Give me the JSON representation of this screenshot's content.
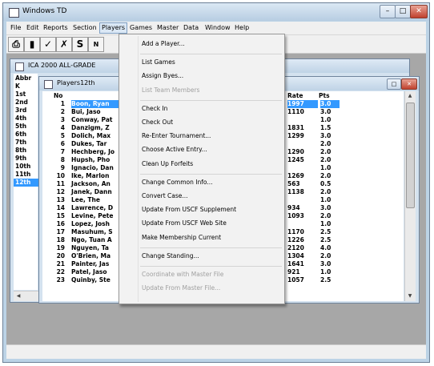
{
  "app": {
    "title": "Windows TD",
    "minimize": "–",
    "maximize": "□",
    "close": "✕"
  },
  "menubar": [
    "File",
    "Edit",
    "Reports",
    "Section",
    "Players",
    "Games",
    "Master",
    "Data",
    "Window",
    "Help"
  ],
  "toolbar": {
    "buttons": [
      {
        "name": "print-icon",
        "glyph": "⎙"
      },
      {
        "name": "bar-chart-icon",
        "glyph": "▮"
      },
      {
        "name": "checkmark-icon",
        "glyph": "✓"
      },
      {
        "name": "double-check-icon",
        "glyph": "✗"
      },
      {
        "name": "s-icon",
        "glyph": "S"
      },
      {
        "name": "n-icon",
        "glyph": "N"
      }
    ]
  },
  "section_window": {
    "title": "ICA 2000 ALL-GRADE",
    "header": "Abbr",
    "rows": [
      "K",
      "1st",
      "2nd",
      "3rd",
      "4th",
      "5th",
      "6th",
      "7th",
      "8th",
      "9th",
      "10th",
      "11th",
      "12th"
    ],
    "selected_index": 12
  },
  "players_window": {
    "title": "Players12th",
    "headers": {
      "no": "No",
      "rate": "Rate",
      "pts": "Pts"
    },
    "rows": [
      {
        "no": "1",
        "name": "Boon, Ryan",
        "rate": "1997",
        "pts": "3.0"
      },
      {
        "no": "2",
        "name": "Bui, Jaso",
        "rate": "1110",
        "pts": "3.0"
      },
      {
        "no": "3",
        "name": "Conway, Pat",
        "rate": "",
        "pts": "1.0"
      },
      {
        "no": "4",
        "name": "Danzigm, Z",
        "rate": "1831",
        "pts": "1.5"
      },
      {
        "no": "5",
        "name": "Dolich, Max",
        "rate": "1299",
        "pts": "3.0"
      },
      {
        "no": "6",
        "name": "Dukes, Tar",
        "rate": "",
        "pts": "2.0"
      },
      {
        "no": "7",
        "name": "Hechberg, Jo",
        "rate": "1290",
        "pts": "2.0"
      },
      {
        "no": "8",
        "name": "Hupsh, Pho",
        "rate": "1245",
        "pts": "2.0"
      },
      {
        "no": "9",
        "name": "Ignacio, Dan",
        "rate": "",
        "pts": "1.0"
      },
      {
        "no": "10",
        "name": "Ike, Marlon",
        "rate": "1269",
        "pts": "2.0"
      },
      {
        "no": "11",
        "name": "Jackson, An",
        "rate": "563",
        "pts": "0.5"
      },
      {
        "no": "12",
        "name": "Janek, Dann",
        "rate": "1138",
        "pts": "2.0"
      },
      {
        "no": "13",
        "name": "Lee, The",
        "rate": "",
        "pts": "1.0"
      },
      {
        "no": "14",
        "name": "Lawrence, D",
        "rate": "934",
        "pts": "3.0"
      },
      {
        "no": "15",
        "name": "Levine, Pete",
        "rate": "1093",
        "pts": "2.0"
      },
      {
        "no": "16",
        "name": "Lopez, Josh",
        "rate": "",
        "pts": "1.0"
      },
      {
        "no": "17",
        "name": "Masuhum, S",
        "rate": "1170",
        "pts": "2.5"
      },
      {
        "no": "18",
        "name": "Ngo, Tuan A",
        "rate": "1226",
        "pts": "2.5"
      },
      {
        "no": "19",
        "name": "Nguyen, Ta",
        "rate": "2120",
        "pts": "4.0"
      },
      {
        "no": "20",
        "name": "O'Brien, Ma",
        "rate": "1304",
        "pts": "2.0"
      },
      {
        "no": "21",
        "name": "Painter, Jas",
        "rate": "1641",
        "pts": "3.0"
      },
      {
        "no": "22",
        "name": "Patel, Jaso",
        "rate": "921",
        "pts": "1.0"
      },
      {
        "no": "23",
        "name": "Quinby, Ste",
        "rate": "1057",
        "pts": "2.5"
      }
    ],
    "selected_index": 0
  },
  "players_menu": {
    "groups": [
      [
        {
          "label": "Add a Player...",
          "enabled": true
        }
      ],
      [
        {
          "label": "List Games",
          "enabled": true
        },
        {
          "label": "Assign Byes...",
          "enabled": true
        },
        {
          "label": "List Team Members",
          "enabled": false
        }
      ],
      [
        {
          "label": "Check In",
          "enabled": true
        },
        {
          "label": "Check Out",
          "enabled": true
        },
        {
          "label": "Re-Enter Tournament...",
          "enabled": true
        },
        {
          "label": "Choose Active Entry...",
          "enabled": true
        },
        {
          "label": "Clean Up Forfeits",
          "enabled": true
        }
      ],
      [
        {
          "label": "Change Common Info...",
          "enabled": true
        },
        {
          "label": "Convert Case...",
          "enabled": true
        },
        {
          "label": "Update From USCF Supplement",
          "enabled": true
        },
        {
          "label": "Update From USCF Web Site",
          "enabled": true
        },
        {
          "label": "Make Membership Current",
          "enabled": true
        }
      ],
      [
        {
          "label": "Change Standing...",
          "enabled": true
        }
      ],
      [
        {
          "label": "Coordinate with Master File",
          "enabled": false
        },
        {
          "label": "Update From Master File...",
          "enabled": false
        }
      ]
    ]
  }
}
